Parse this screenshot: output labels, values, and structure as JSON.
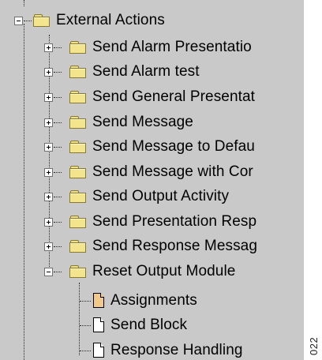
{
  "tree": {
    "root": {
      "label": "External Actions",
      "state": "expanded",
      "icon": "folder-icon"
    },
    "items": [
      {
        "label": "Send Alarm Presentatio",
        "state": "collapsed",
        "icon": "folder-icon"
      },
      {
        "label": "Send Alarm test",
        "state": "collapsed",
        "icon": "folder-icon"
      },
      {
        "label": "Send General Presentat",
        "state": "collapsed",
        "icon": "folder-icon"
      },
      {
        "label": "Send Message",
        "state": "collapsed",
        "icon": "folder-icon"
      },
      {
        "label": "Send Message to Defau",
        "state": "collapsed",
        "icon": "folder-icon"
      },
      {
        "label": "Send Message with Cor",
        "state": "collapsed",
        "icon": "folder-icon"
      },
      {
        "label": "Send Output Activity",
        "state": "collapsed",
        "icon": "folder-icon"
      },
      {
        "label": "Send Presentation Resp",
        "state": "collapsed",
        "icon": "folder-icon"
      },
      {
        "label": "Send Response Messag",
        "state": "collapsed",
        "icon": "folder-icon"
      },
      {
        "label": "Reset Output Module",
        "state": "expanded",
        "icon": "folder-icon"
      }
    ],
    "children": [
      {
        "label": "Assignments",
        "icon": "document-tan-icon"
      },
      {
        "label": "Send Block",
        "icon": "document-icon"
      },
      {
        "label": "Response Handling",
        "icon": "document-icon"
      }
    ]
  },
  "side_code": "022",
  "colors": {
    "panel_bg": "#c9c9c9",
    "folder": "#f3e58e",
    "doc_tan": "#f3c98a"
  }
}
